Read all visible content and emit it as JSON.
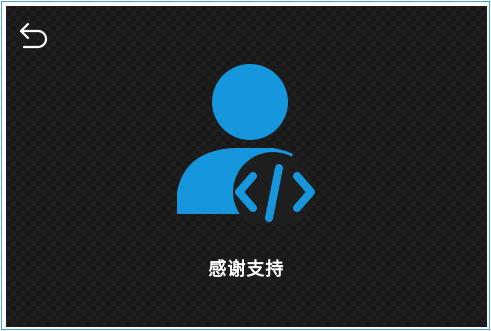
{
  "screen": {
    "caption": "感谢支持",
    "accent_color": "#1596dd",
    "background_color": "#1e1e1e"
  },
  "icons": {
    "back": "back-arrow-icon",
    "main": "developer-user-code-icon"
  }
}
